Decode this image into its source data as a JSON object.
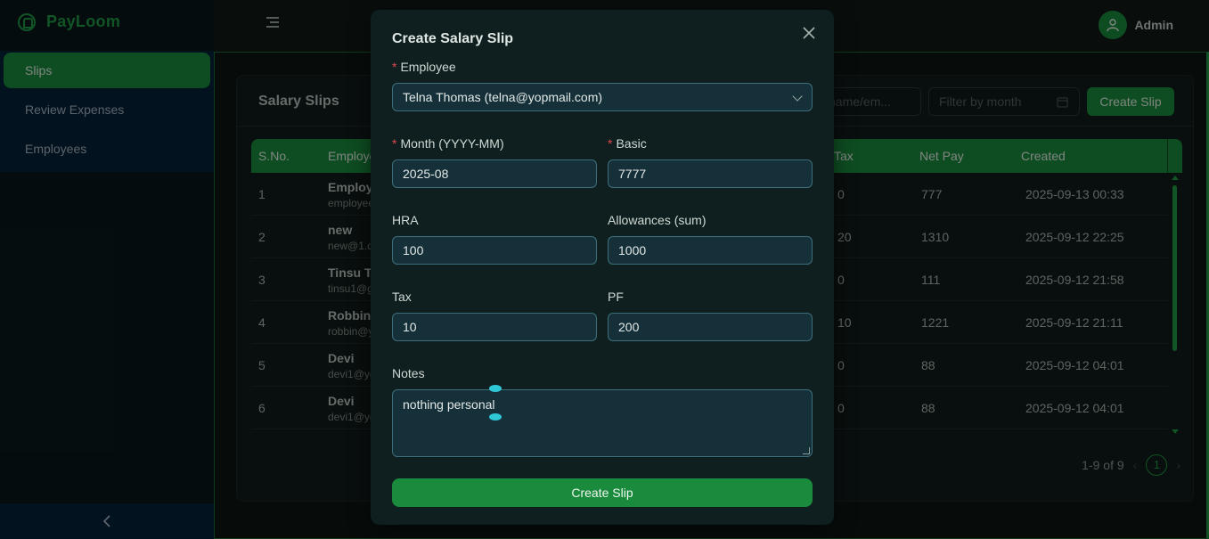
{
  "app": {
    "name": "PayLoom"
  },
  "sidebar": {
    "items": [
      {
        "label": "Slips",
        "active": true
      },
      {
        "label": "Review Expenses",
        "active": false
      },
      {
        "label": "Employees",
        "active": false
      }
    ],
    "collapse_icon": "chevron-left-icon"
  },
  "header": {
    "user_label": "Admin",
    "menu_icon": "menu-fold-icon",
    "avatar_icon": "user-icon"
  },
  "page": {
    "title": "Salary Slips",
    "search_placeholder": "name/em...",
    "month_filter_placeholder": "Filter by month",
    "create_button": "Create Slip",
    "table": {
      "columns": [
        "S.No.",
        "Employee",
        "Tax",
        "Net Pay",
        "Created"
      ],
      "rows": [
        {
          "sno": "1",
          "name": "Employ",
          "email": "employee",
          "tax": "0",
          "net": "777",
          "created": "2025-09-13 00:33"
        },
        {
          "sno": "2",
          "name": "new",
          "email": "new@1.d",
          "tax": "20",
          "net": "1310",
          "created": "2025-09-12 22:25"
        },
        {
          "sno": "3",
          "name": "Tinsu Tl",
          "email": "tinsu1@g",
          "tax": "0",
          "net": "111",
          "created": "2025-09-12 21:58"
        },
        {
          "sno": "4",
          "name": "Robbin",
          "email": "robbin@y",
          "tax": "10",
          "net": "1221",
          "created": "2025-09-12 21:11"
        },
        {
          "sno": "5",
          "name": "Devi",
          "email": "devi1@yc",
          "tax": "0",
          "net": "88",
          "created": "2025-09-12 04:01"
        },
        {
          "sno": "6",
          "name": "Devi",
          "email": "devi1@yc",
          "tax": "0",
          "net": "88",
          "created": "2025-09-12 04:01"
        }
      ]
    },
    "pagination": {
      "summary": "1-9 of 9",
      "current": "1",
      "prev_icon": "chevron-left-icon",
      "next_icon": "chevron-right-icon"
    }
  },
  "modal": {
    "title": "Create Salary Slip",
    "close_icon": "close-icon",
    "fields": {
      "employee": {
        "label": "Employee",
        "required": true,
        "value": "Telna Thomas (telna@yopmail.com)"
      },
      "month": {
        "label": "Month (YYYY-MM)",
        "required": true,
        "value": "2025-08"
      },
      "basic": {
        "label": "Basic",
        "required": true,
        "value": "7777"
      },
      "hra": {
        "label": "HRA",
        "value": "100"
      },
      "allowances": {
        "label": "Allowances (sum)",
        "value": "1000"
      },
      "tax": {
        "label": "Tax",
        "value": "10"
      },
      "pf": {
        "label": "PF",
        "value": "200"
      },
      "notes": {
        "label": "Notes",
        "value": "nothing personal"
      }
    },
    "submit": "Create Slip"
  },
  "colors": {
    "accent": "#1a8a3c",
    "brand": "#1f9b45",
    "required": "#e0484e",
    "sidebar_nav": "#05213a"
  }
}
